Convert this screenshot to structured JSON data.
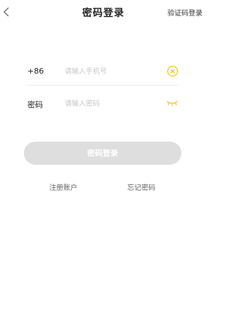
{
  "header": {
    "title": "密码登录",
    "alt_login": "验证码登录"
  },
  "phone_row": {
    "prefix": "+86",
    "placeholder": "请输入手机号",
    "value": "",
    "clear_icon": "clear-circle-icon"
  },
  "password_row": {
    "label": "密码",
    "placeholder": "请输入密码",
    "value": "",
    "toggle_icon": "eye-closed-icon"
  },
  "login_button": {
    "label": "密码登录"
  },
  "links": {
    "register": "注册账户",
    "forgot": "忘记密码"
  },
  "colors": {
    "accent": "#f5c518",
    "button_disabled": "#dedede",
    "placeholder": "#c7c7c7",
    "divider": "#ececec"
  }
}
